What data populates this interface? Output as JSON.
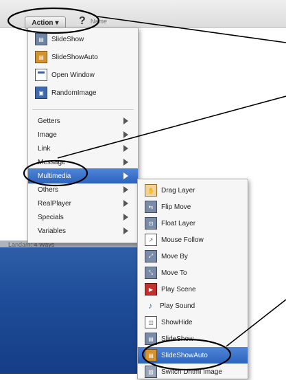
{
  "toolbar": {
    "action_label": "Action",
    "action_caret": "▾",
    "help_label": "?",
    "trailing_text": "Name"
  },
  "desktop": {
    "status_text": "Landam: 4 Ways"
  },
  "menu": {
    "items": [
      {
        "label": "SlideShow",
        "icon": "slideshow-icon"
      },
      {
        "label": "SlideShowAuto",
        "icon": "slideshow-auto-icon"
      },
      {
        "label": "Open Window",
        "icon": "open-window-icon"
      },
      {
        "label": "RandomImage",
        "icon": "random-image-icon"
      }
    ],
    "submenus": [
      {
        "label": "Getters"
      },
      {
        "label": "Image"
      },
      {
        "label": "Link"
      },
      {
        "label": "Message"
      },
      {
        "label": "Multimedia",
        "selected": true
      },
      {
        "label": "Others"
      },
      {
        "label": "RealPlayer"
      },
      {
        "label": "Specials"
      },
      {
        "label": "Variables"
      }
    ]
  },
  "submenu": {
    "items": [
      {
        "label": "Drag Layer",
        "icon": "drag-layer-icon"
      },
      {
        "label": "Flip Move",
        "icon": "flip-move-icon"
      },
      {
        "label": "Float Layer",
        "icon": "float-layer-icon"
      },
      {
        "label": "Mouse Follow",
        "icon": "mouse-follow-icon"
      },
      {
        "label": "Move By",
        "icon": "move-by-icon"
      },
      {
        "label": "Move To",
        "icon": "move-to-icon"
      },
      {
        "label": "Play Scene",
        "icon": "play-scene-icon"
      },
      {
        "label": "Play Sound",
        "icon": "play-sound-icon"
      },
      {
        "label": "ShowHide",
        "icon": "show-hide-icon"
      },
      {
        "label": "SlideShow",
        "icon": "slideshow-icon"
      },
      {
        "label": "SlideShowAuto",
        "icon": "slideshow-auto-icon",
        "selected": true
      },
      {
        "label": "Switch Dhtml Image",
        "icon": "switch-image-icon"
      }
    ]
  },
  "colors": {
    "selection": "#2c63bd",
    "desktop": "#1f4d98",
    "callout": "#000000"
  }
}
